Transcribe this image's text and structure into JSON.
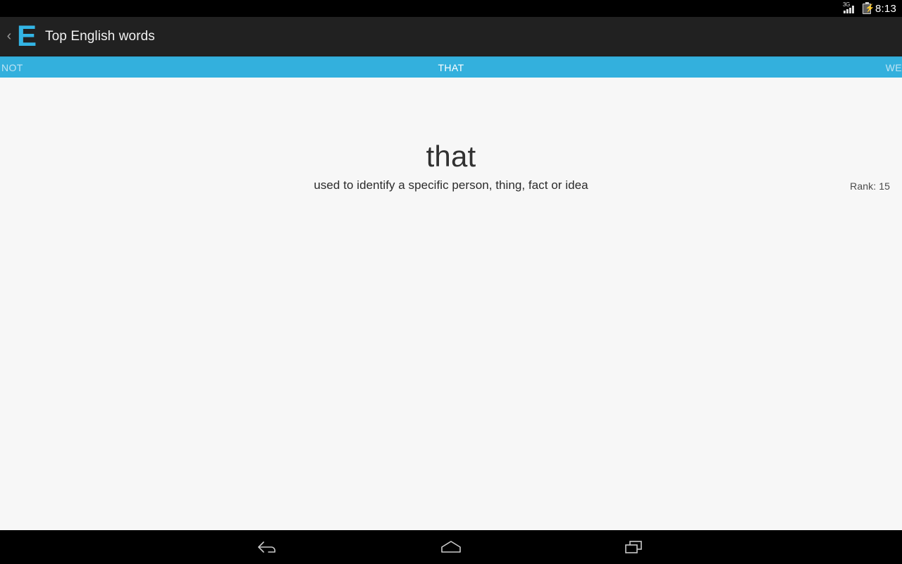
{
  "status_bar": {
    "network_label": "3G",
    "time": "8:13",
    "signal_icon": "signal-bars-icon",
    "battery_icon": "battery-charging-icon",
    "bolt_glyph": "⚡"
  },
  "action_bar": {
    "up_chevron": "‹",
    "logo_letter": "E",
    "title": "Top English words",
    "logo_color": "#33b5e5",
    "background_color": "#212121"
  },
  "tabs": {
    "accent_color": "#33b0dd",
    "items": [
      {
        "label": "NOT",
        "state": "previous"
      },
      {
        "label": "THAT",
        "state": "selected"
      },
      {
        "label": "WE",
        "state": "next"
      }
    ]
  },
  "content": {
    "rank": "Rank: 15",
    "word": "that",
    "definition": "used to identify a specific person, thing, fact or idea",
    "background_color": "#f7f7f7"
  },
  "nav_bar": {
    "back_label": "Back",
    "home_label": "Home",
    "recents_label": "Recent apps"
  }
}
